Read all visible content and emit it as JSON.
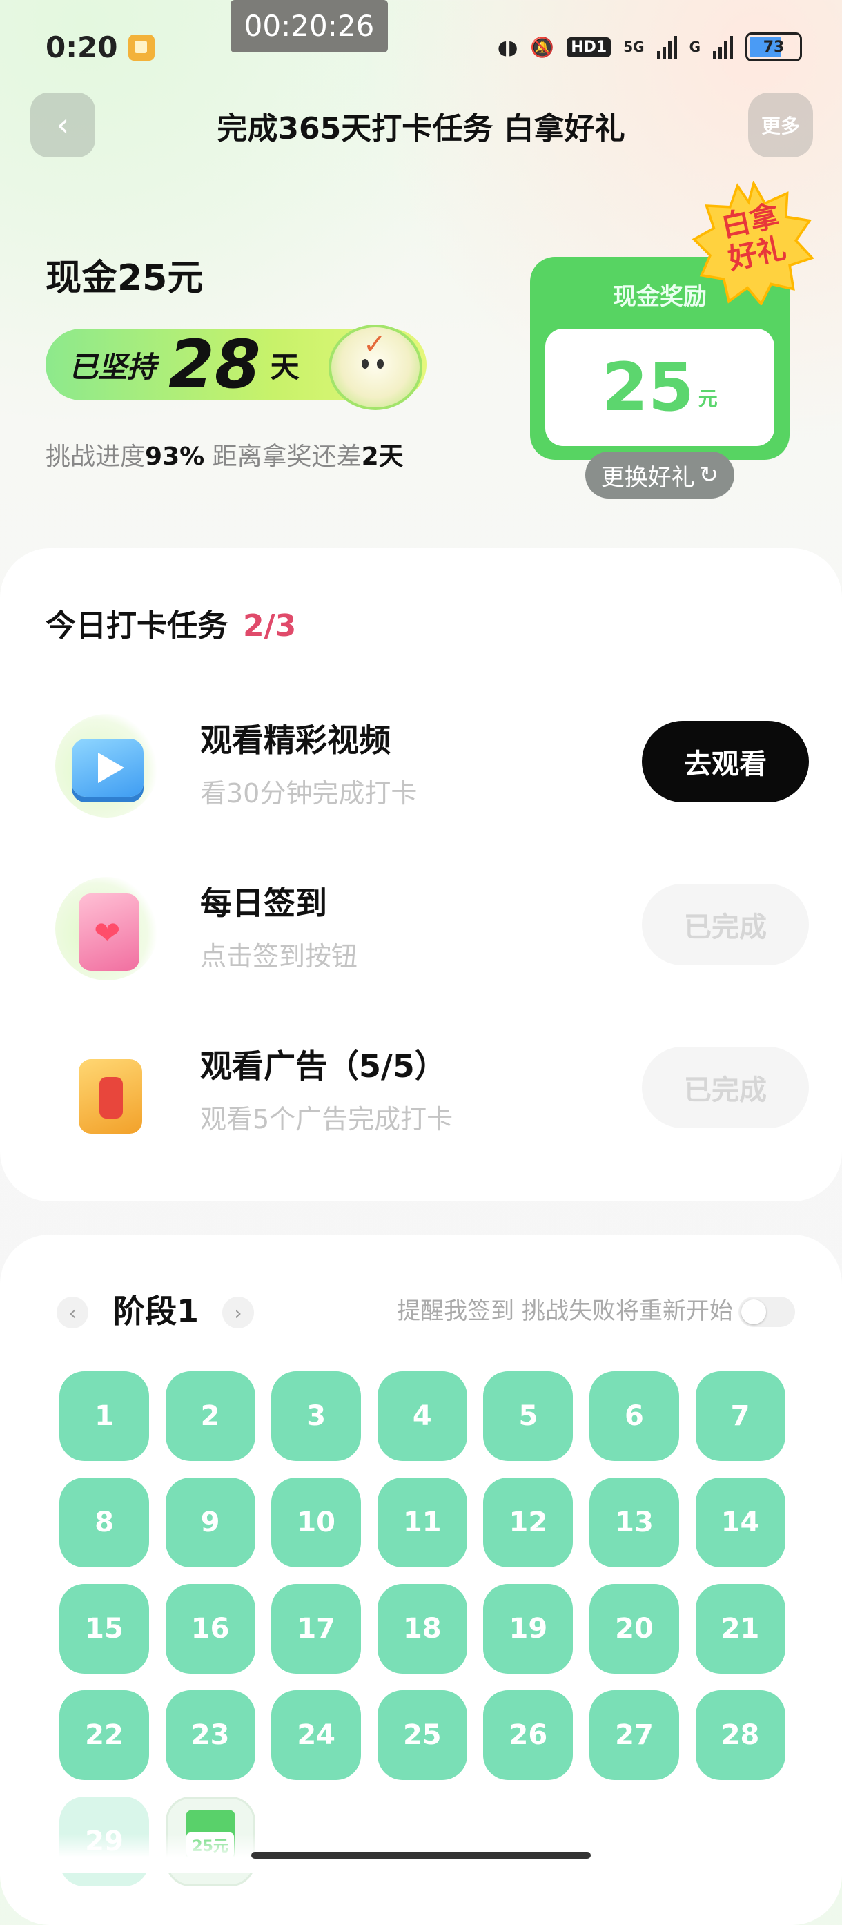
{
  "status_bar": {
    "time": "0:20",
    "timer": "00:20:26",
    "hd_label": "HD1",
    "net_5g": "5G",
    "net_g": "G",
    "battery": "73"
  },
  "header": {
    "title": "完成365天打卡任务 白拿好礼",
    "more_label": "更多"
  },
  "reward": {
    "cash_title": "现金25元",
    "streak_prefix": "已坚持",
    "streak_days": "28",
    "streak_unit": "天",
    "progress_prefix": "挑战进度",
    "progress_value": "93%",
    "progress_middle": " 距离拿奖还差",
    "remaining_days": "2天",
    "card_label": "现金奖励",
    "card_amount": "25",
    "card_unit": "元",
    "badge_line1": "白拿",
    "badge_line2": "好礼",
    "swap_label": "更换好礼",
    "swap_icon": "refresh-icon"
  },
  "tasks": {
    "heading": "今日打卡任务",
    "count": "2/3",
    "items": [
      {
        "name": "观看精彩视频",
        "desc": "看30分钟完成打卡",
        "button": "去观看",
        "icon": "video-play-icon",
        "state": "active"
      },
      {
        "name": "每日签到",
        "desc": "点击签到按钮",
        "button": "已完成",
        "icon": "calendar-heart-icon",
        "state": "done"
      },
      {
        "name": "观看广告（5/5）",
        "desc": "观看5个广告完成打卡",
        "button": "已完成",
        "icon": "gift-box-icon",
        "state": "done"
      }
    ]
  },
  "calendar": {
    "stage_label": "阶段1",
    "reminder_text": "提醒我签到 挑战失败将重新开始",
    "reminder_toggle_on": false,
    "days": [
      "1",
      "2",
      "3",
      "4",
      "5",
      "6",
      "7",
      "8",
      "9",
      "10",
      "11",
      "12",
      "13",
      "14",
      "15",
      "16",
      "17",
      "18",
      "19",
      "20",
      "21",
      "22",
      "23",
      "24",
      "25",
      "26",
      "27",
      "28",
      "29"
    ],
    "reward_day_label": "25元",
    "colors": {
      "day_done": "#7adfb6",
      "accent_green": "#57d462",
      "count_pink": "#e04a6a"
    }
  }
}
